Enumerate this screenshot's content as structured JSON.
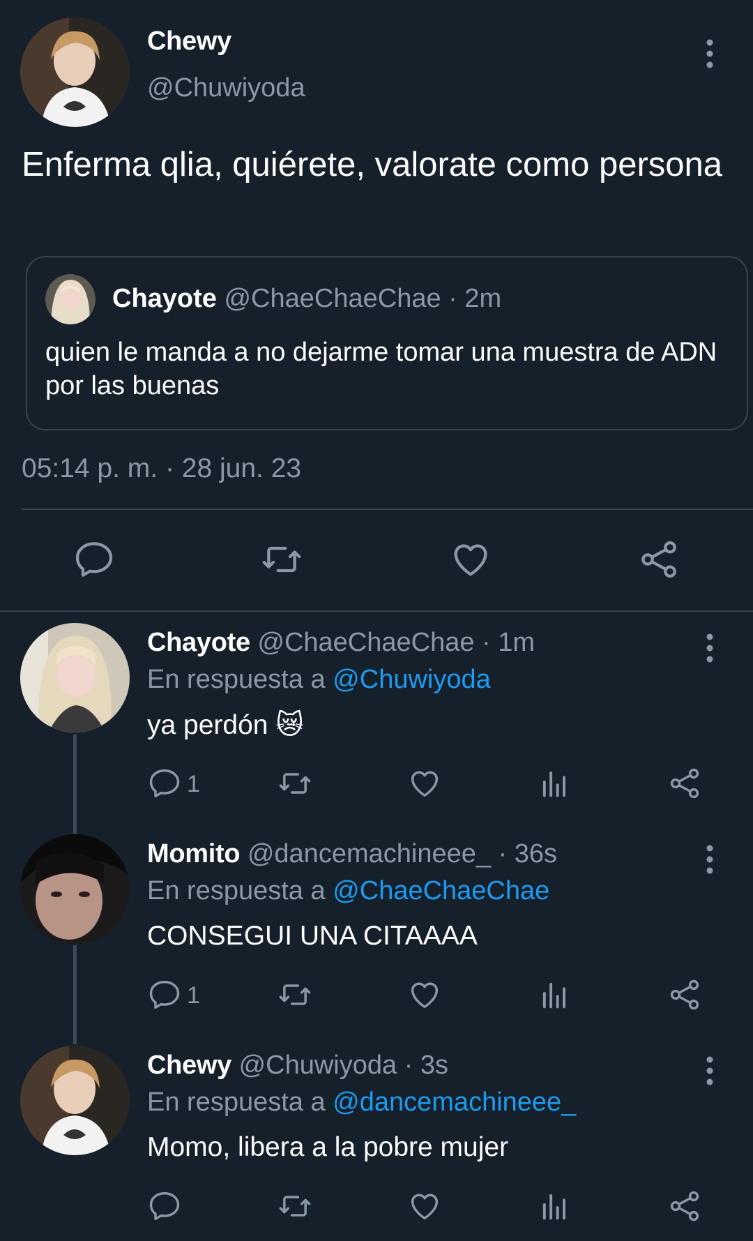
{
  "main_tweet": {
    "name": "Chewy",
    "handle": "@Chuwiyoda",
    "text": "Enferma qlia, quiérete, valorate como persona",
    "quoted": {
      "name": "Chayote",
      "meta": "@ChaeChaeChae · 2m",
      "text": "quien le manda a no dejarme tomar una muestra de ADN por las buenas"
    },
    "timestamp": "05:14 p. m. · 28 jun. 23",
    "actions": [
      "reply-icon",
      "retweet-icon",
      "like-icon",
      "share-icon"
    ]
  },
  "replies": [
    {
      "name": "Chayote",
      "meta": "@ChaeChaeChae · 1m",
      "reply_prefix": "En respuesta a",
      "reply_to": "@Chuwiyoda",
      "text": "ya perdón 😿",
      "reply_count": "1"
    },
    {
      "name": "Momito",
      "meta": "@dancemachineee_ · 36s",
      "reply_prefix": "En respuesta a",
      "reply_to": "@ChaeChaeChae",
      "text": "CONSEGUI UNA CITAAAA",
      "reply_count": "1"
    },
    {
      "name": "Chewy",
      "meta": "@Chuwiyoda · 3s",
      "reply_prefix": "En respuesta a",
      "reply_to": "@dancemachineee_",
      "text": "Momo, libera a la pobre mujer",
      "reply_count": ""
    }
  ],
  "colors": {
    "background": "#15202b",
    "muted": "#8b98a5",
    "link": "#1d9bf0",
    "border": "#38444d"
  }
}
